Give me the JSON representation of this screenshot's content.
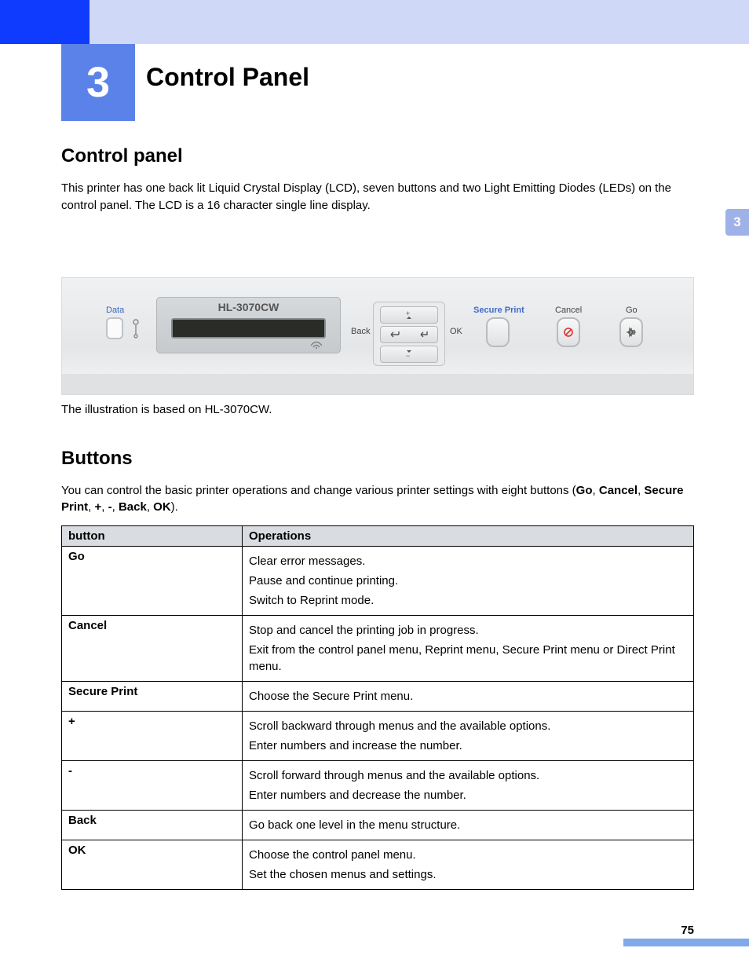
{
  "chapter": {
    "number": "3",
    "title": "Control Panel"
  },
  "side_tab": "3",
  "section_cp": {
    "heading": "Control panel",
    "para": "This printer has one back lit Liquid Crystal Display (LCD), seven buttons and two Light Emitting Diodes (LEDs) on the control panel. The LCD is a 16 character single line display."
  },
  "panel": {
    "data_label": "Data",
    "lcd_model": "HL-3070CW",
    "back_label": "Back",
    "ok_label": "OK",
    "secure_label": "Secure Print",
    "cancel_label": "Cancel",
    "go_label": "Go"
  },
  "caption": "The illustration is based on HL-3070CW.",
  "section_btn": {
    "heading": "Buttons",
    "para_pre": "You can control the basic printer operations and change various printer settings with eight buttons (",
    "bold1": "Go",
    "sep1": ", ",
    "bold2": "Cancel",
    "sep2": ", ",
    "bold3": "Secure Print",
    "sep3": ", ",
    "bold4": "+",
    "sep4": ", ",
    "bold5": "-",
    "sep5": ", ",
    "bold6": "Back",
    "sep6": ", ",
    "bold7": "OK",
    "para_post": ")."
  },
  "table": {
    "head_button": "button",
    "head_ops": "Operations",
    "rows": [
      {
        "name": "Go",
        "ops": [
          "Clear error messages.",
          "Pause and continue printing.",
          "Switch to Reprint mode."
        ]
      },
      {
        "name": "Cancel",
        "ops": [
          "Stop and cancel the printing job in progress.",
          "Exit from the control panel menu, Reprint menu, Secure Print menu or Direct Print menu."
        ]
      },
      {
        "name": "Secure Print",
        "ops": [
          "Choose the Secure Print menu."
        ]
      },
      {
        "name": "+",
        "ops": [
          "Scroll backward through menus and the available options.",
          "Enter numbers and increase the number."
        ]
      },
      {
        "name": "-",
        "ops": [
          "Scroll forward through menus and the available options.",
          "Enter numbers and decrease the number."
        ]
      },
      {
        "name": "Back",
        "ops": [
          "Go back one level in the menu structure."
        ]
      },
      {
        "name": "OK",
        "ops": [
          "Choose the control panel menu.",
          "Set the chosen menus and settings."
        ]
      }
    ]
  },
  "page_number": "75"
}
